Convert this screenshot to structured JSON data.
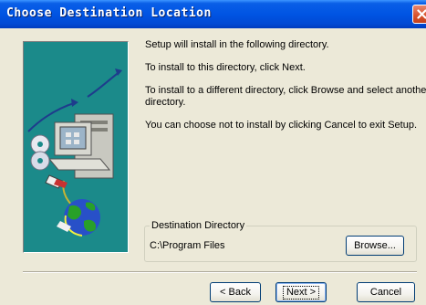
{
  "window": {
    "title": "Choose Destination Location",
    "close_icon": "close-icon"
  },
  "body": {
    "line1": "Setup will install  in the following directory.",
    "line2": "To install to this directory, click Next.",
    "line3a": "To install to a different directory, click Browse and select another",
    "line3b": "directory.",
    "line4": "You can choose not to install  by clicking Cancel to exit Setup."
  },
  "destination": {
    "label": "Destination Directory",
    "path": "C:\\Program Files",
    "browse_label": "Browse..."
  },
  "buttons": {
    "back_label": "< Back",
    "next_label": "Next >",
    "cancel_label": "Cancel"
  },
  "colors": {
    "title_bar": "#0054E3",
    "close_button": "#D6522A",
    "art_background": "#1B8A8A",
    "window_background": "#ECE9D8"
  }
}
